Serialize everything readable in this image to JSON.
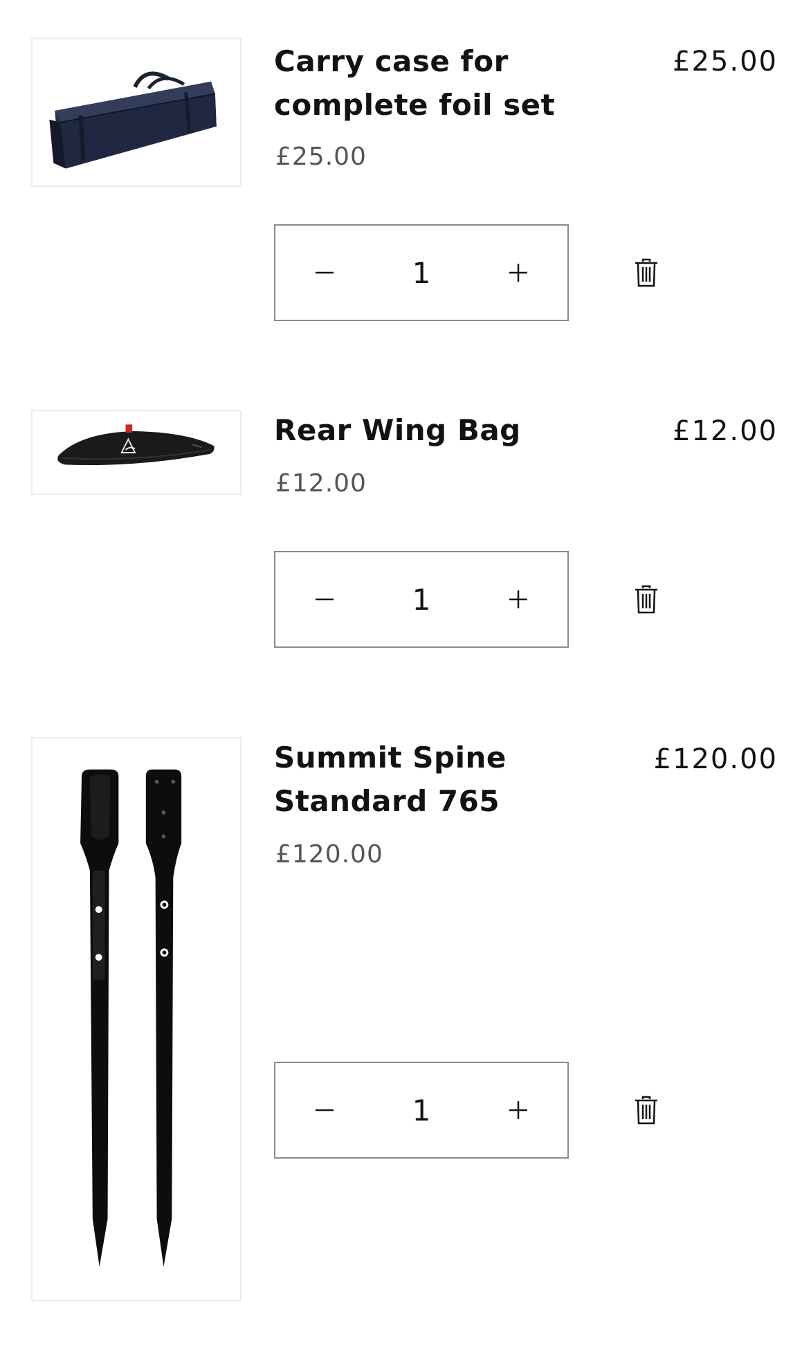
{
  "cart": {
    "items": [
      {
        "title": "Carry case for complete foil set",
        "unit_price": "£25.00",
        "line_total": "£25.00",
        "quantity": "1",
        "image_icon": "foil-carry-case-image"
      },
      {
        "title": "Rear Wing Bag",
        "unit_price": "£12.00",
        "line_total": "£12.00",
        "quantity": "1",
        "image_icon": "rear-wing-bag-image"
      },
      {
        "title": "Summit Spine Standard 765",
        "unit_price": "£120.00",
        "line_total": "£120.00",
        "quantity": "1",
        "image_icon": "spine-mast-image"
      }
    ]
  },
  "icons": {
    "decrease": "minus-icon",
    "increase": "plus-icon",
    "remove": "trash-icon"
  },
  "colors": {
    "text": "#121212",
    "muted_price": "#555555",
    "border": "#8a8a8a"
  }
}
